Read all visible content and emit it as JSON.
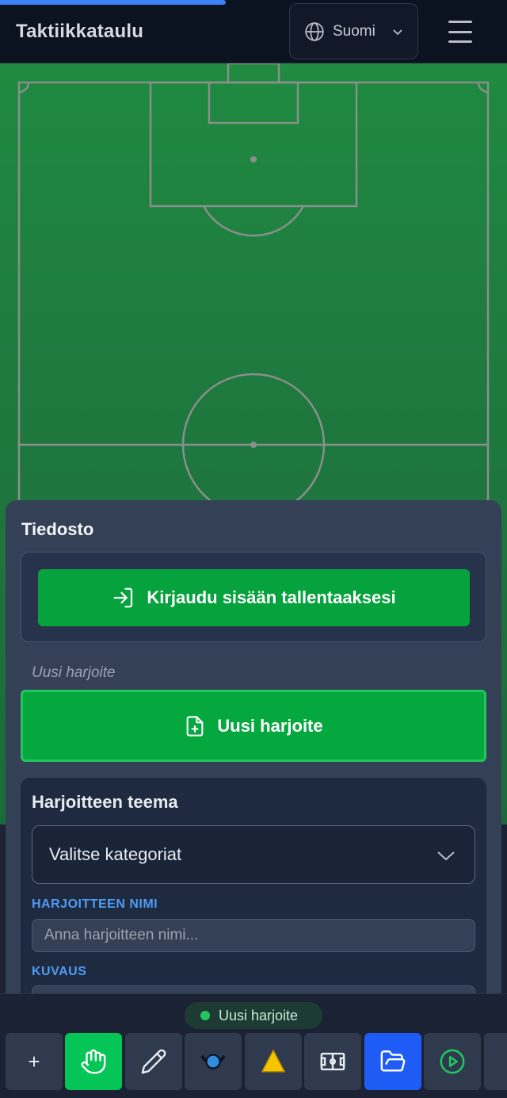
{
  "header": {
    "title": "Taktiikkataulu",
    "language": "Suomi"
  },
  "panel": {
    "title": "Tiedosto",
    "login_label": "Kirjaudu sisään tallentaaksesi",
    "section_label": "Uusi harjoite",
    "new_button_label": "Uusi harjoite",
    "theme_title": "Harjoitteen teema",
    "category_select": "Valitse kategoriat",
    "name_label": "HARJOITTEEN NIMI",
    "name_placeholder": "Anna harjoitteen nimi...",
    "description_label": "KUVAUS"
  },
  "status": {
    "text": "Uusi harjoite"
  },
  "toolbar": {
    "add_label": "+",
    "items": [
      "add",
      "hand-icon",
      "pencil-icon",
      "player-icon",
      "cone-icon",
      "pitch-icon",
      "folder-icon",
      "play-icon"
    ]
  },
  "colors": {
    "accent_green": "#05a23d",
    "active_blue": "#1f5cf6",
    "pitch_green": "#1f7a3f"
  }
}
